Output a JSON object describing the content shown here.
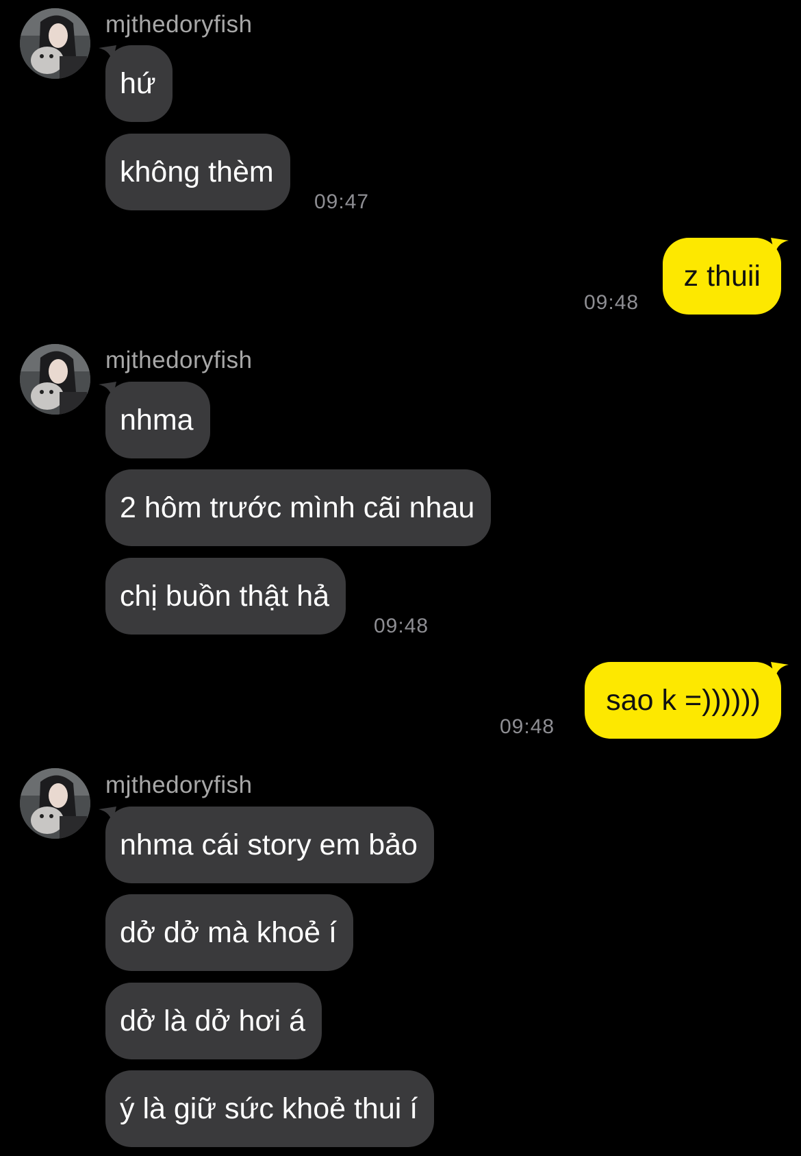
{
  "colors": {
    "background": "#000000",
    "incoming_bubble": "#3a3a3c",
    "outgoing_bubble": "#fde800",
    "sender_name": "#a8a8a8",
    "timestamp": "#8e8e93"
  },
  "avatar_icon": "profile-photo",
  "groups": [
    {
      "sender": "mjthedoryfish",
      "messages": [
        "hứ",
        "không thèm"
      ],
      "time": "09:47"
    },
    {
      "outgoing": true,
      "messages": [
        "z thuii"
      ],
      "time": "09:48"
    },
    {
      "sender": "mjthedoryfish",
      "messages": [
        "nhma",
        "2 hôm trước mình cãi nhau",
        "chị buồn thật hả"
      ],
      "time": "09:48"
    },
    {
      "outgoing": true,
      "messages": [
        "sao k =))))))"
      ],
      "time": "09:48"
    },
    {
      "sender": "mjthedoryfish",
      "messages": [
        "nhma cái story em bảo",
        "dở dở mà khoẻ í",
        "dở là dở hơi á",
        "ý là giữ sức khoẻ thui í"
      ]
    }
  ]
}
